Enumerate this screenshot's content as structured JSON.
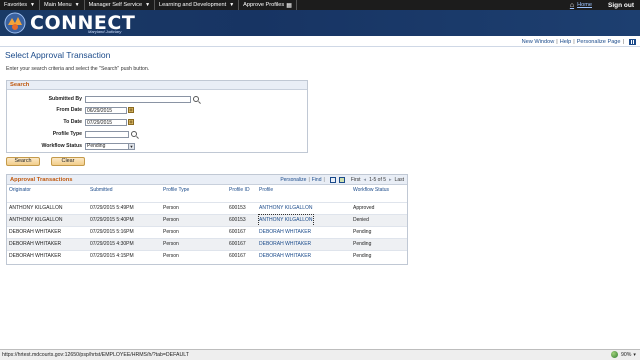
{
  "nav": {
    "items": [
      {
        "label": "Favorites",
        "caret": "▼"
      },
      {
        "label": "Main Menu",
        "caret": "▼"
      },
      {
        "label": "Manager Self Service",
        "caret": "▼"
      },
      {
        "label": "Learning and Development",
        "caret": "▼"
      },
      {
        "label": "Approve Profiles",
        "caret": ""
      }
    ],
    "home_label": "Home",
    "signout_label": "Sign out"
  },
  "banner": {
    "brand": "CONNECT",
    "subtitle": "Maryland Judiciary"
  },
  "page_links": {
    "new_window": "New Window",
    "help": "Help",
    "personalize_page": "Personalize Page",
    "separator": "|"
  },
  "page": {
    "title": "Select Approval Transaction",
    "instructions": "Enter your search criteria and select the \"Search\" push button."
  },
  "search": {
    "header": "Search",
    "submitted_by_label": "Submitted By",
    "submitted_by_value": "",
    "from_date_label": "From Date",
    "from_date_value": "06/29/2015",
    "to_date_label": "To Date",
    "to_date_value": "07/29/2015",
    "profile_type_label": "Profile Type",
    "profile_type_value": "",
    "workflow_status_label": "Workflow Status",
    "workflow_status_value": "Pending",
    "search_button": "Search",
    "clear_button": "Clear"
  },
  "grid": {
    "title": "Approval Transactions",
    "personalize": "Personalize",
    "find": "Find",
    "first": "First",
    "range": "1-5 of 5",
    "last": "Last",
    "columns": [
      "Originator",
      "Submitted",
      "Profile Type",
      "Profile ID",
      "Profile",
      "Workflow Status"
    ],
    "rows": [
      [
        "ANTHONY KILGALLON",
        "07/29/2015  5:49PM",
        "Person",
        "600153",
        "ANTHONY KILGALLON",
        "Approved"
      ],
      [
        "ANTHONY KILGALLON",
        "07/29/2015  5:40PM",
        "Person",
        "600153",
        "ANTHONY KILGALLON",
        "Denied"
      ],
      [
        "DEBORAH WHITAKER",
        "07/29/2015  5:16PM",
        "Person",
        "600167",
        "DEBORAH WHITAKER",
        "Pending"
      ],
      [
        "DEBORAH WHITAKER",
        "07/29/2015  4:30PM",
        "Person",
        "600167",
        "DEBORAH WHITAKER",
        "Pending"
      ],
      [
        "DEBORAH WHITAKER",
        "07/29/2015  4:15PM",
        "Person",
        "600167",
        "DEBORAH WHITAKER",
        "Pending"
      ]
    ]
  },
  "statusbar": {
    "url": "https://hrtest.mdcourts.gov:12650/psp/hrtst/EMPLOYEE/HRMS/h/?tab=DEFAULT",
    "zoom": "90%"
  },
  "colors": {
    "accent": "#1a4a8a",
    "section_title": "#c05a10",
    "banner": "#173463"
  }
}
